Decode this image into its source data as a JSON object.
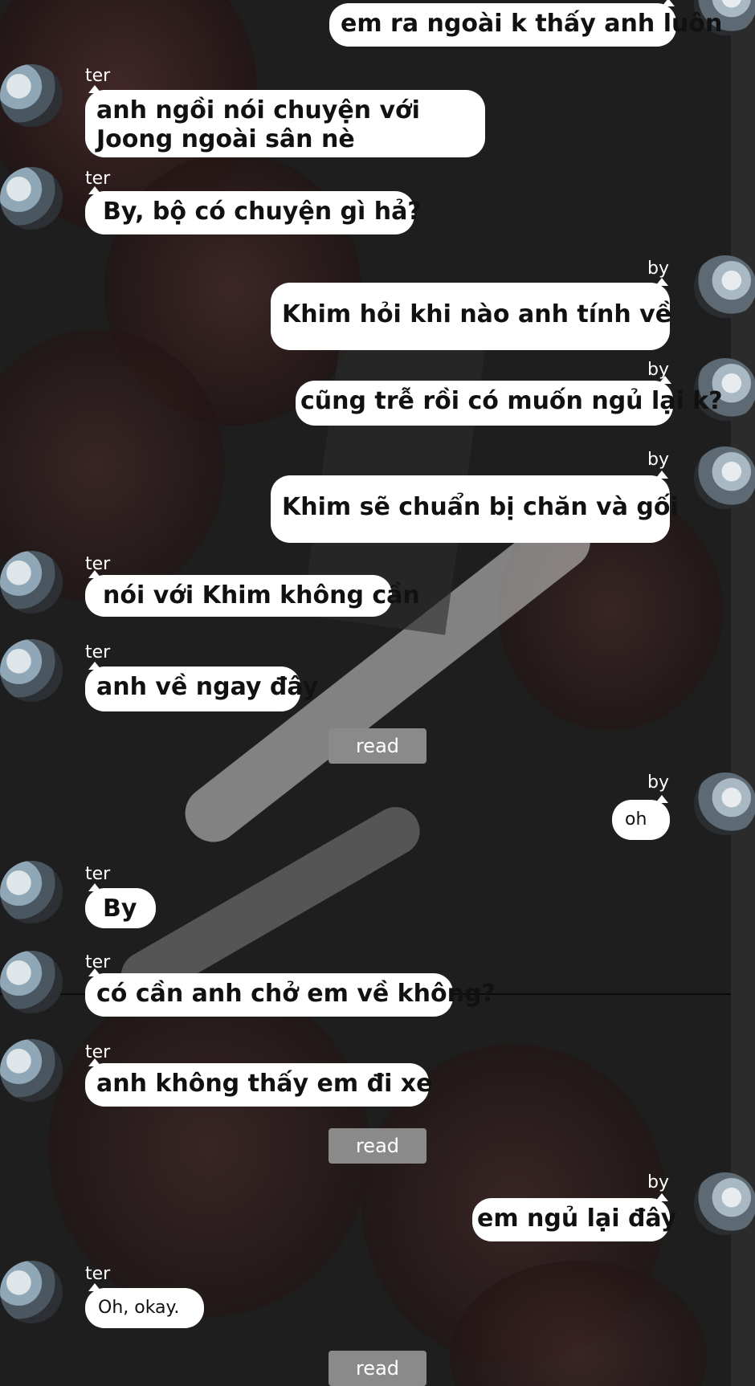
{
  "messages": [
    {
      "sender": "",
      "text": "em ra ngoài k thấy anh luôn"
    },
    {
      "sender": "ter",
      "text": "anh ngồi nói chuyện với Joong ngoài sân nè"
    },
    {
      "sender": "ter",
      "text": "By, bộ có chuyện gì hả?"
    },
    {
      "sender": "by",
      "text": "Khim hỏi khi nào anh tính về"
    },
    {
      "sender": "by",
      "text": "cũng trễ rồi có muốn ngủ lại k?"
    },
    {
      "sender": "by",
      "text": "Khim sẽ chuẩn bị chăn và gối"
    },
    {
      "sender": "ter",
      "text": "nói với Khim không cần"
    },
    {
      "sender": "ter",
      "text": "anh về ngay đây"
    },
    {
      "sender": "by",
      "text": "oh"
    },
    {
      "sender": "ter",
      "text": "By"
    },
    {
      "sender": "ter",
      "text": "có cần anh chở em về không?"
    },
    {
      "sender": "ter",
      "text": "anh không thấy em đi xe"
    },
    {
      "sender": "by",
      "text": "em ngủ lại đây"
    },
    {
      "sender": "ter",
      "text": "Oh, okay."
    }
  ],
  "read_label": "read",
  "colors": {
    "bubble": "#ffffff",
    "read_badge": "#8a8a8a",
    "name_text": "#ffffff",
    "background": "#1e1e1e"
  }
}
